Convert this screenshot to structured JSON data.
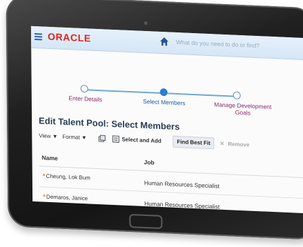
{
  "header": {
    "brand": "ORACLE",
    "search_placeholder": "What do you need to do or find?"
  },
  "train": {
    "stops": [
      {
        "label": "Enter Details",
        "state": "visited"
      },
      {
        "label": "Select Members",
        "state": "current"
      },
      {
        "label": "Manage Development Goals",
        "state": "upcoming"
      }
    ]
  },
  "page": {
    "title": "Edit Talent Pool: Select Members"
  },
  "toolbar": {
    "view_label": "View ▼",
    "format_label": "Format ▼",
    "select_and_add_label": "Select and Add",
    "find_best_fit_label": "Find Best Fit",
    "remove_label": "Remove"
  },
  "table": {
    "columns": [
      "Name",
      "Job"
    ],
    "rows": [
      {
        "name": "Cheung, Lok Bum",
        "job": "Human Resources Specialist"
      },
      {
        "name": "Demaros, Janice",
        "job": "Human Resources Specialist"
      }
    ]
  },
  "colors": {
    "brand_red": "#e0221b",
    "header_bg": "#dcebf8",
    "train_active": "#2a7fd0",
    "link_purple": "#8a2a6e"
  },
  "icons": [
    "hamburger-menu-icon",
    "home-icon",
    "detach-icon",
    "select-add-icon",
    "remove-x-icon",
    "flag-icon"
  ]
}
